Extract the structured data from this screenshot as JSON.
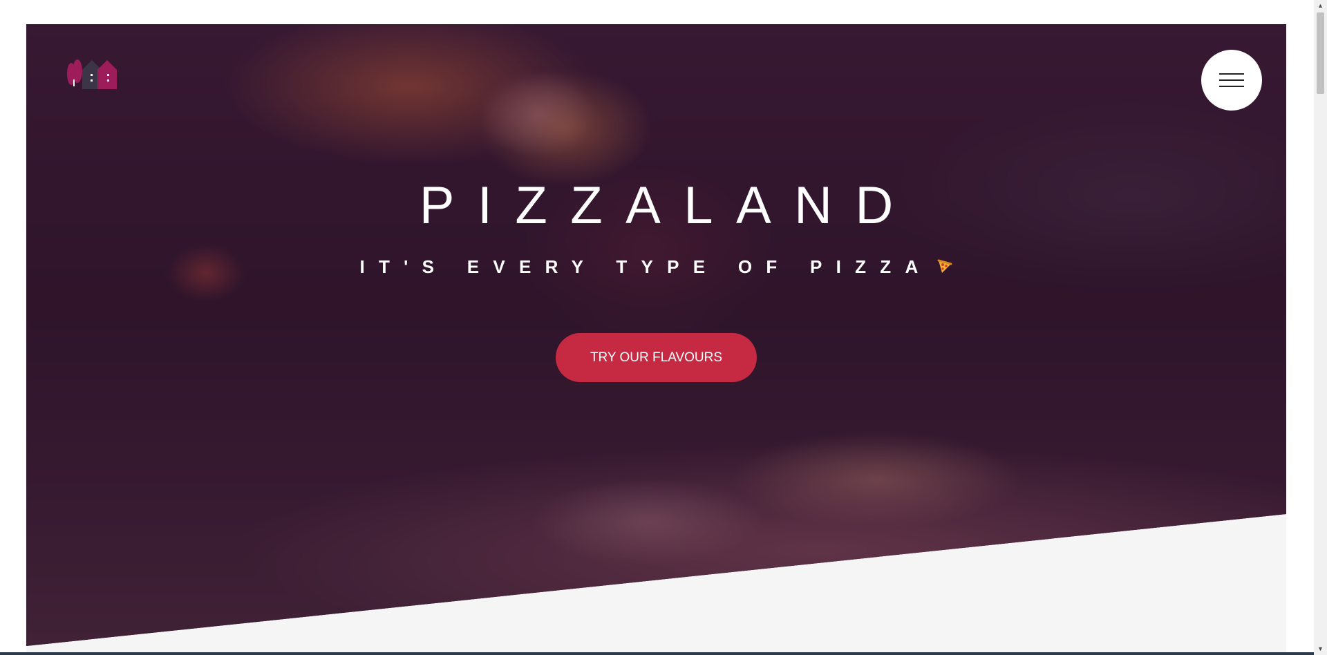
{
  "header": {
    "logo_icon": "village-houses-logo",
    "menu_icon": "hamburger-menu-icon"
  },
  "hero": {
    "title": "PIZZALAND",
    "subtitle": "IT'S EVERY TYPE OF PIZZA",
    "subtitle_icon": "pizza-slice-icon",
    "cta_label": "TRY OUR FLAVOURS"
  },
  "colors": {
    "cta_background": "#c62a43",
    "hero_tint": "#3a1d35",
    "section_background": "#f6f5f6",
    "logo_primary": "#9c1d5a",
    "logo_secondary": "#3c3447"
  }
}
